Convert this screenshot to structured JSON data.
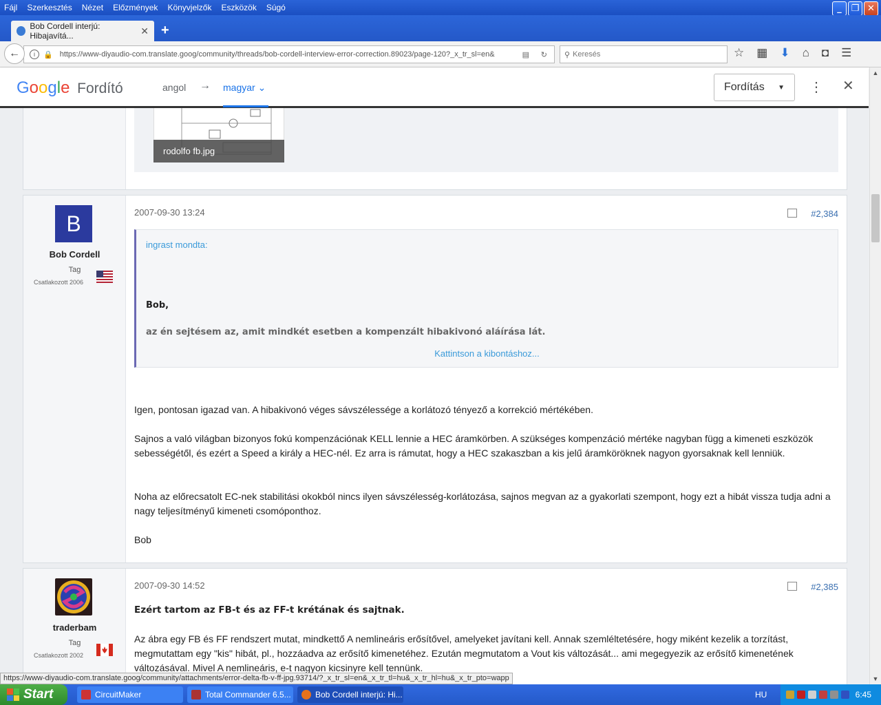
{
  "menubar": {
    "items": [
      "Fájl",
      "Szerkesztés",
      "Nézet",
      "Előzmények",
      "Könyvjelzők",
      "Eszközök",
      "Súgó"
    ],
    "window_controls": [
      "_",
      "❐",
      "✕"
    ]
  },
  "tab": {
    "title": "Bob Cordell interjú: Hibajavítá...",
    "close": "✕",
    "new_tab": "+"
  },
  "navbar": {
    "url": "https://www-diyaudio-com.translate.goog/community/threads/bob-cordell-interview-error-correction.89023/page-120?_x_tr_sl=en&",
    "search_placeholder": "Keresés"
  },
  "gtranslate": {
    "brand": [
      "G",
      "o",
      "o",
      "g",
      "l",
      "e"
    ],
    "product": "Fordító",
    "from_lang": "angol",
    "arrow": "→",
    "to_lang": "magyar",
    "translate_button": "Fordítás"
  },
  "prev_post": {
    "attachment_name": "rodolfo fb.jpg"
  },
  "post1": {
    "avatar_letter": "B",
    "username": "Bob Cordell",
    "role": "Tag",
    "joined": "Csatlakozott 2006",
    "date": "2007-09-30 13:24",
    "number": "#2,384",
    "quote": {
      "author": "ingrast mondta:",
      "line1": "Bob,",
      "line2": "az én sejtésem az, amit mindkét esetben a kompenzált hibakivonó aláírása lát.",
      "expand": "Kattintson a kibontáshoz..."
    },
    "paragraphs": [
      "Igen, pontosan igazad van. A hibakivonó véges sávszélessége a korlátozó tényező a korrekció mértékében.",
      "Sajnos a való világban bizonyos fokú kompenzációnak KELL lennie a HEC áramkörben. A szükséges kompenzáció mértéke nagyban függ a kimeneti eszközök sebességétől, és ezért a Speed a király a HEC-nél. Ez arra is rámutat, hogy a HEC szakaszban a kis jelű áramköröknek nagyon gyorsaknak kell lenniük.",
      "Noha az előrecsatolt EC-nek stabilitási okokból nincs ilyen sávszélesség-korlátozása, sajnos megvan az a gyakorlati szempont, hogy ezt a hibát vissza tudja adni a nagy teljesítményű kimeneti csomóponthoz.",
      "Bob"
    ]
  },
  "post2": {
    "username": "traderbam",
    "role": "Tag",
    "joined": "Csatlakozott 2002",
    "date": "2007-09-30 14:52",
    "number": "#2,385",
    "heading": "Ezért tartom az FB-t és az FF-t krétának és sajtnak.",
    "paragraph": "Az ábra egy FB és FF rendszert mutat, mindkettő A nemlineáris erősítővel, amelyeket javítani kell. Annak szemléltetésére, hogy miként kezelik a torzítást, megmutattam egy \"kis\" hibát, pl., hozzáadva az erősítő kimenetéhez. Ezután megmutatom a Vout kis változását... ami megegyezik az erősítő kimenetének változásával. Mivel A nemlineáris, e-t nagyon kicsinyre kell tennünk."
  },
  "statusbar": {
    "text": "https://www-diyaudio-com.translate.goog/community/attachments/error-delta-fb-v-ff-jpg.93714/?_x_tr_sl=en&_x_tr_tl=hu&_x_tr_hl=hu&_x_tr_pto=wapp"
  },
  "taskbar": {
    "start": "Start",
    "buttons": [
      "CircuitMaker",
      "Total Commander 6.5...",
      "Bob Cordell interjú: Hi..."
    ],
    "lang": "HU",
    "clock": "6:45"
  },
  "colors": {
    "link": "#3a9ad9",
    "quote_border": "#6b69b3",
    "avatar_b": "#2b3a9e",
    "translate_blue": "#1a73e8"
  }
}
